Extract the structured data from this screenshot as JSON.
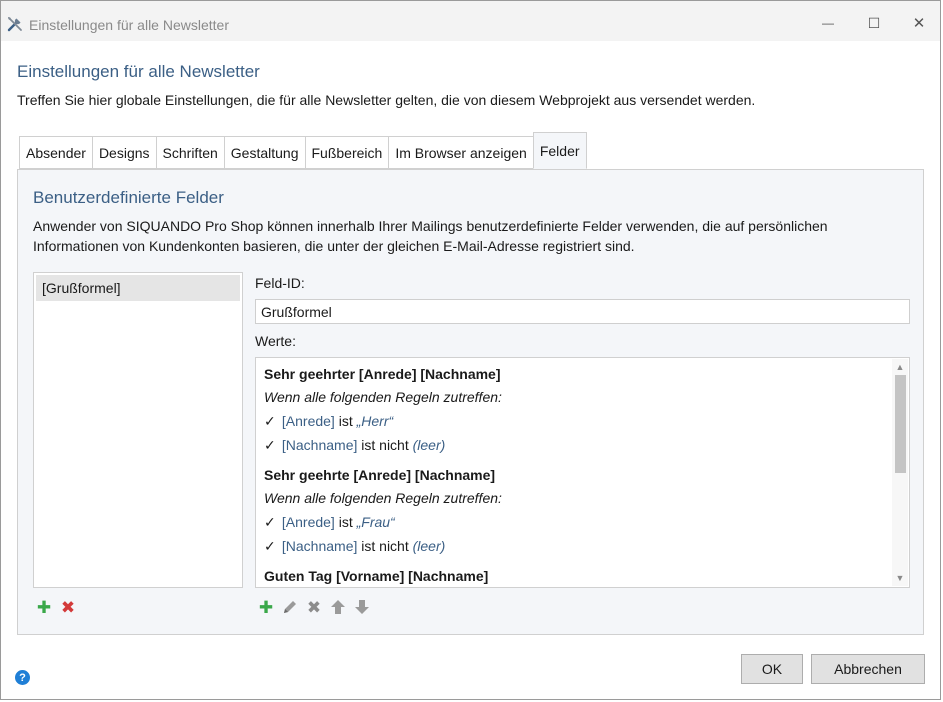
{
  "window": {
    "title": "Einstellungen für alle Newsletter",
    "icon": "tools-icon",
    "controls": {
      "minimize": "—",
      "maximize": "☐",
      "close": "✕"
    }
  },
  "header": {
    "title": "Einstellungen für alle Newsletter",
    "description": "Treffen Sie hier globale Einstellungen, die für alle Newsletter gelten, die von diesem Webprojekt aus versendet werden."
  },
  "tabs": [
    {
      "label": "Absender",
      "active": false
    },
    {
      "label": "Designs",
      "active": false
    },
    {
      "label": "Schriften",
      "active": false
    },
    {
      "label": "Gestaltung",
      "active": false
    },
    {
      "label": "Fußbereich",
      "active": false
    },
    {
      "label": "Im Browser anzeigen",
      "active": false
    },
    {
      "label": "Felder",
      "active": true
    }
  ],
  "panel": {
    "title": "Benutzerdefinierte Felder",
    "description": "Anwender von SIQUANDO Pro Shop können innerhalb Ihrer Mailings benutzerdefinierte Felder verwenden, die auf persönlichen Informationen von Kundenkonten basieren, die unter der gleichen E-Mail-Adresse registriert sind.",
    "fields_list": [
      "[Grußformel]"
    ],
    "field_id_label": "Feld-ID:",
    "field_id_value": "Grußformel",
    "values_label": "Werte:",
    "values": [
      {
        "title": "Sehr geehrter [Anrede] [Nachname]",
        "condition": "Wenn alle folgenden Regeln zutreffen:",
        "rules": [
          {
            "field": "[Anrede]",
            "op": "ist",
            "value": "„Herr“"
          },
          {
            "field": "[Nachname]",
            "op": "ist nicht",
            "value": "(leer)"
          }
        ]
      },
      {
        "title": "Sehr geehrte [Anrede] [Nachname]",
        "condition": "Wenn alle folgenden Regeln zutreffen:",
        "rules": [
          {
            "field": "[Anrede]",
            "op": "ist",
            "value": "„Frau“"
          },
          {
            "field": "[Nachname]",
            "op": "ist nicht",
            "value": "(leer)"
          }
        ]
      },
      {
        "title": "Guten Tag [Vorname] [Nachname]"
      }
    ],
    "check_glyph": "✓"
  },
  "footer": {
    "help": "?",
    "ok_label": "OK",
    "cancel_label": "Abbrechen"
  },
  "colors": {
    "accent": "#3b5f85",
    "add": "#3aa84a",
    "delete": "#d33a3a"
  }
}
